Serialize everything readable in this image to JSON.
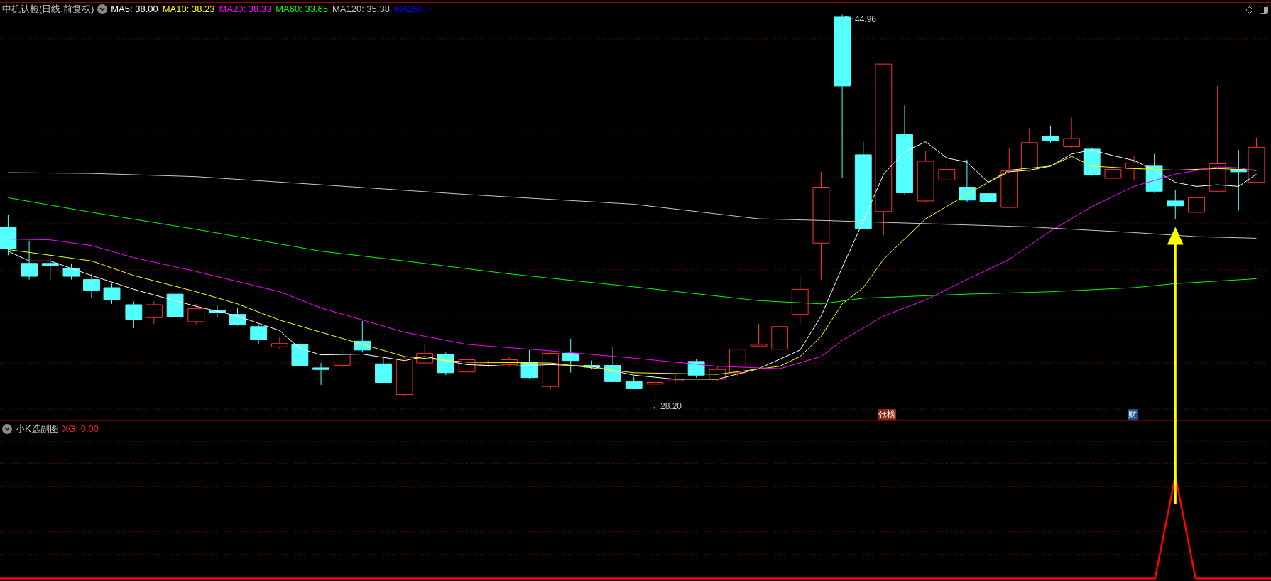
{
  "main_pane": {
    "title": "中机认检(日线.前复权)",
    "indicators": [
      {
        "label": "MA5: 38.00",
        "color": "#ffffff"
      },
      {
        "label": "MA10: 38.23",
        "color": "#ffff00"
      },
      {
        "label": "MA20: 38.33",
        "color": "#ff00ff"
      },
      {
        "label": "MA60: 33.65",
        "color": "#00ff00"
      },
      {
        "label": "MA120: 35.38",
        "color": "#c8c8c8"
      },
      {
        "label": "MA250: -",
        "color": "#0000ff"
      }
    ],
    "price_labels": [
      "44.96",
      "←28.20"
    ],
    "event_markers": [
      {
        "label": "张榜",
        "color": "#8a2a10"
      },
      {
        "label": "财",
        "color": "#1d4f8f"
      }
    ]
  },
  "sub_pane": {
    "title": "小K选副图",
    "reading": "XG: 0.00"
  }
}
